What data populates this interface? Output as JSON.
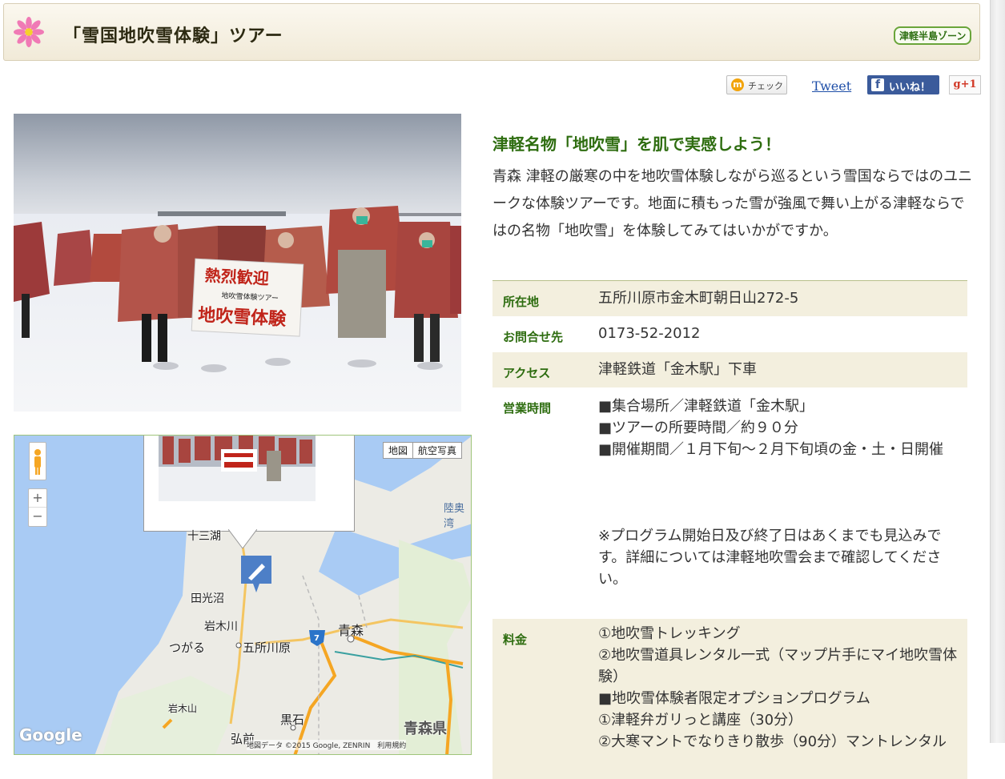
{
  "header": {
    "title": "「雪国地吹雪体験」ツアー",
    "zone_badge": "津軽半島ゾーン"
  },
  "social": {
    "check_label": "チェック",
    "tweet_label": "Tweet",
    "like_label": "いいね！",
    "gplus_label": "g+1"
  },
  "photo": {
    "banner_line1": "熱烈歓迎",
    "banner_line2": "地吹雪体験ツアー",
    "banner_line3": "地吹雪体験"
  },
  "map": {
    "type_buttons": [
      "地図",
      "航空写真"
    ],
    "labels": {
      "jusanko": "十三湖",
      "tankozuma": "田光沼",
      "iwakigawa": "岩木川",
      "tsugaru": "つがる",
      "goshogawara": "五所川原",
      "aomori": "青森",
      "route": "7",
      "kuroishi": "黒石",
      "iwakisan": "岩木山",
      "hirosaki": "弘前",
      "aomori_pref": "青森県",
      "mutsu_bay": "陸奥湾"
    },
    "google_logo": "Google",
    "attribution": "地図データ ©2015 Google, ZENRIN　利用規約",
    "zoom_in": "+",
    "zoom_out": "−"
  },
  "content": {
    "catch": "津軽名物「地吹雪」を肌で実感しよう！",
    "description": "青森 津軽の厳寒の中を地吹雪体験しながら巡るという雪国ならではのユニークな体験ツアーです。地面に積もった雪が強風で舞い上がる津軽ならではの名物「地吹雪」を体験してみてはいかがですか。"
  },
  "info": {
    "address": {
      "label": "所在地",
      "value": "五所川原市金木町朝日山272-5"
    },
    "contact": {
      "label": "お問合せ先",
      "value": "0173-52-2012"
    },
    "access": {
      "label": "アクセス",
      "value": "津軽鉄道「金木駅」下車"
    },
    "hours": {
      "label": "営業時間",
      "lines": [
        "■集合場所／津軽鉄道「金木駅」",
        "■ツアーの所要時間／約９０分",
        "■開催期間／１月下旬～２月下旬頃の金・土・日開催"
      ],
      "note": "※プログラム開始日及び終了日はあくまでも見込みです。詳細については津軽地吹雪会まで確認してください。"
    },
    "fee": {
      "label": "料金",
      "lines": [
        "①地吹雪トレッキング",
        "②地吹雪道具レンタル一式（マップ片手にマイ地吹雪体験）",
        "■地吹雪体験者限定オプションプログラム",
        "①津軽弁ガリっと講座（30分）",
        "②大寒マントでなりきり散歩（90分）マントレンタル"
      ]
    }
  }
}
